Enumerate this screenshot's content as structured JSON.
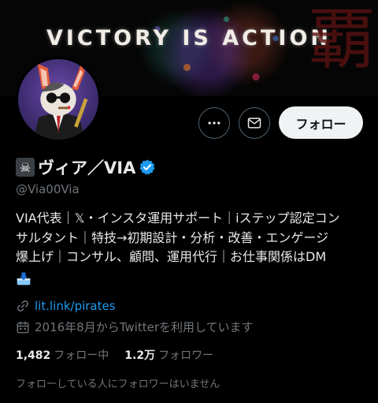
{
  "banner": {
    "title": "VICTORY IS ACTION",
    "kanji": "覇"
  },
  "actions": {
    "more_icon": "more-horizontal-icon",
    "message_icon": "mail-icon",
    "follow_label": "フォロー"
  },
  "profile": {
    "name_emoji": "☠",
    "name": "ヴィア／VIA",
    "verified_icon": "verified-badge-icon",
    "handle": "@Via00Via",
    "bio_lines": [
      "VIA代表｜𝕏・インスタ運用サポート｜iステップ認定コン",
      "サルタント｜特技→初期設計・分析・改善・エンゲージ",
      "爆上げ｜コンサル、顧問、運用代行｜お仕事関係はDM"
    ],
    "bio_emoji_icon": "inbox-tray-icon",
    "link": "lit.link/pirates",
    "joined": "2016年8月からTwitterを利用しています"
  },
  "stats": {
    "following_count": "1,482",
    "following_label": "フォロー中",
    "followers_count": "1.2万",
    "followers_label": "フォロワー"
  },
  "followed_by_text": "フォローしている人にフォロワーはいません",
  "colors": {
    "background": "#000000",
    "text": "#e7e9ea",
    "muted": "#71767b",
    "link": "#1d9bf0",
    "verified": "#1d9bf0",
    "follow_button": "#eff3f4"
  }
}
